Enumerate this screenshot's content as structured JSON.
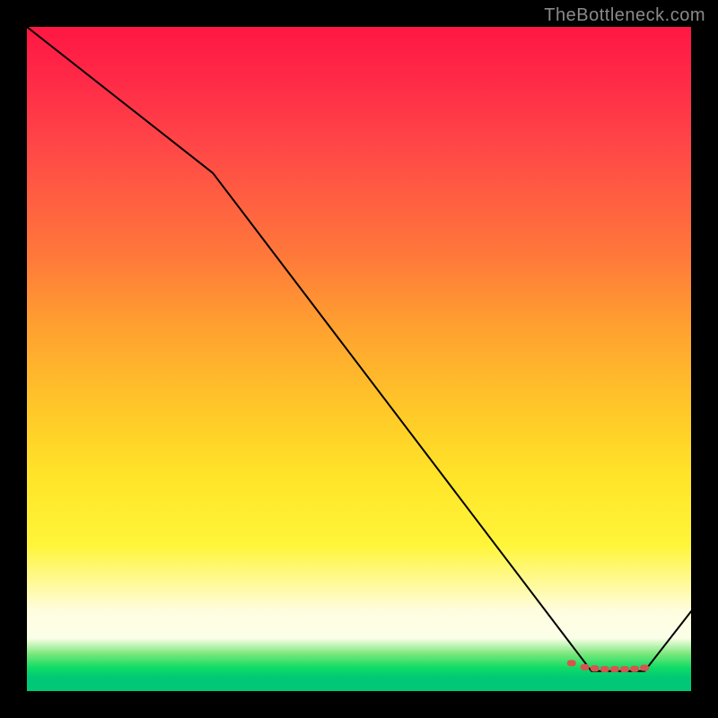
{
  "watermark": "TheBottleneck.com",
  "chart_data": {
    "type": "line",
    "title": "",
    "xlabel": "",
    "ylabel": "",
    "xlim": [
      0,
      100
    ],
    "ylim": [
      0,
      100
    ],
    "grid": false,
    "legend": false,
    "background_gradient": {
      "direction": "vertical",
      "stops": [
        {
          "pos": 0,
          "color": "#ff1744"
        },
        {
          "pos": 0.35,
          "color": "#ff7a3a"
        },
        {
          "pos": 0.58,
          "color": "#ffc928"
        },
        {
          "pos": 0.78,
          "color": "#fff539"
        },
        {
          "pos": 0.9,
          "color": "#fcffe8"
        },
        {
          "pos": 0.96,
          "color": "#0fdc66"
        },
        {
          "pos": 1.0,
          "color": "#00c876"
        }
      ]
    },
    "series": [
      {
        "name": "curve",
        "color": "#000000",
        "stroke_width": 2,
        "x": [
          0,
          28,
          85,
          93,
          100
        ],
        "y": [
          100,
          78,
          3,
          3,
          12
        ]
      }
    ],
    "markers": {
      "name": "bottom-cluster",
      "color": "#d9534f",
      "shape": "round",
      "x": [
        82,
        84,
        85.5,
        87,
        88.5,
        90,
        91.5,
        93
      ],
      "y": [
        4.2,
        3.6,
        3.4,
        3.3,
        3.3,
        3.3,
        3.35,
        3.5
      ]
    }
  }
}
